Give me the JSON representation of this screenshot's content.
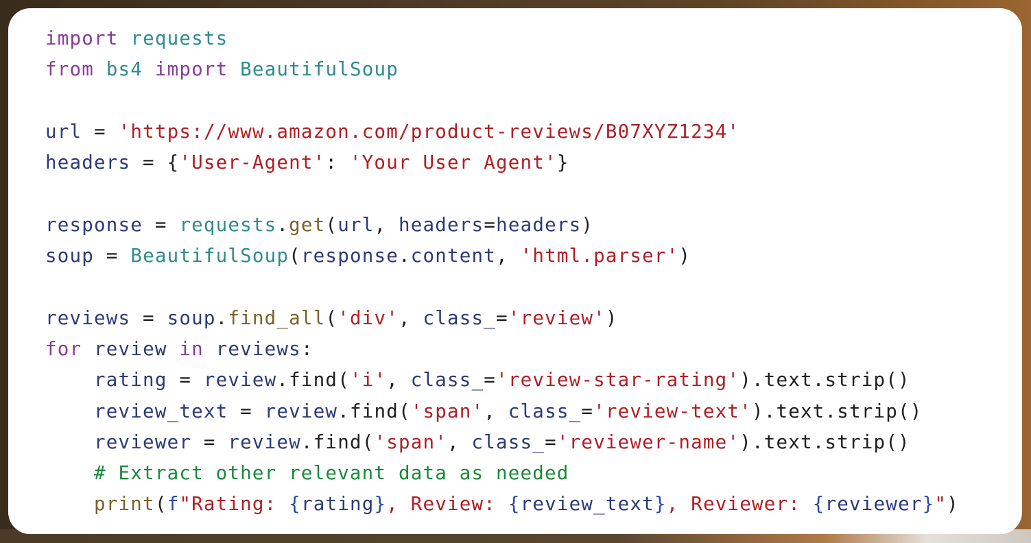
{
  "code_block": {
    "language": "python",
    "lines": [
      [
        {
          "t": "kw",
          "v": "import"
        },
        {
          "t": "op",
          "v": " "
        },
        {
          "t": "mod",
          "v": "requests"
        }
      ],
      [
        {
          "t": "kw",
          "v": "from"
        },
        {
          "t": "op",
          "v": " "
        },
        {
          "t": "mod",
          "v": "bs4"
        },
        {
          "t": "op",
          "v": " "
        },
        {
          "t": "kw",
          "v": "import"
        },
        {
          "t": "op",
          "v": " "
        },
        {
          "t": "mod",
          "v": "BeautifulSoup"
        }
      ],
      [],
      [
        {
          "t": "var",
          "v": "url"
        },
        {
          "t": "op",
          "v": " = "
        },
        {
          "t": "str",
          "v": "'https://www.amazon.com/product-reviews/B07XYZ1234'"
        }
      ],
      [
        {
          "t": "var",
          "v": "headers"
        },
        {
          "t": "op",
          "v": " = {"
        },
        {
          "t": "str",
          "v": "'User-Agent'"
        },
        {
          "t": "op",
          "v": ": "
        },
        {
          "t": "str",
          "v": "'Your User Agent'"
        },
        {
          "t": "op",
          "v": "}"
        }
      ],
      [],
      [
        {
          "t": "var",
          "v": "response"
        },
        {
          "t": "op",
          "v": " = "
        },
        {
          "t": "mod",
          "v": "requests"
        },
        {
          "t": "op",
          "v": "."
        },
        {
          "t": "fn",
          "v": "get"
        },
        {
          "t": "op",
          "v": "("
        },
        {
          "t": "var",
          "v": "url"
        },
        {
          "t": "op",
          "v": ", "
        },
        {
          "t": "var",
          "v": "headers"
        },
        {
          "t": "op",
          "v": "="
        },
        {
          "t": "var",
          "v": "headers"
        },
        {
          "t": "op",
          "v": ")"
        }
      ],
      [
        {
          "t": "var",
          "v": "soup"
        },
        {
          "t": "op",
          "v": " = "
        },
        {
          "t": "mod",
          "v": "BeautifulSoup"
        },
        {
          "t": "op",
          "v": "("
        },
        {
          "t": "var",
          "v": "response"
        },
        {
          "t": "op",
          "v": "."
        },
        {
          "t": "var",
          "v": "content"
        },
        {
          "t": "op",
          "v": ", "
        },
        {
          "t": "str",
          "v": "'html.parser'"
        },
        {
          "t": "op",
          "v": ")"
        }
      ],
      [],
      [
        {
          "t": "var",
          "v": "reviews"
        },
        {
          "t": "op",
          "v": " = "
        },
        {
          "t": "var",
          "v": "soup"
        },
        {
          "t": "op",
          "v": "."
        },
        {
          "t": "fn",
          "v": "find_all"
        },
        {
          "t": "op",
          "v": "("
        },
        {
          "t": "str",
          "v": "'div'"
        },
        {
          "t": "op",
          "v": ", "
        },
        {
          "t": "var",
          "v": "class_"
        },
        {
          "t": "op",
          "v": "="
        },
        {
          "t": "str",
          "v": "'review'"
        },
        {
          "t": "op",
          "v": ")"
        }
      ],
      [
        {
          "t": "kw",
          "v": "for"
        },
        {
          "t": "op",
          "v": " "
        },
        {
          "t": "var",
          "v": "review"
        },
        {
          "t": "op",
          "v": " "
        },
        {
          "t": "kw",
          "v": "in"
        },
        {
          "t": "op",
          "v": " "
        },
        {
          "t": "var",
          "v": "reviews"
        },
        {
          "t": "op",
          "v": ":"
        }
      ],
      [
        {
          "t": "op",
          "v": "    "
        },
        {
          "t": "var",
          "v": "rating"
        },
        {
          "t": "op",
          "v": " = "
        },
        {
          "t": "var",
          "v": "review"
        },
        {
          "t": "op",
          "v": ".find("
        },
        {
          "t": "str",
          "v": "'i'"
        },
        {
          "t": "op",
          "v": ", "
        },
        {
          "t": "var",
          "v": "class_"
        },
        {
          "t": "op",
          "v": "="
        },
        {
          "t": "str",
          "v": "'review-star-rating'"
        },
        {
          "t": "op",
          "v": ").text.strip()"
        }
      ],
      [
        {
          "t": "op",
          "v": "    "
        },
        {
          "t": "var",
          "v": "review_text"
        },
        {
          "t": "op",
          "v": " = "
        },
        {
          "t": "var",
          "v": "review"
        },
        {
          "t": "op",
          "v": ".find("
        },
        {
          "t": "str",
          "v": "'span'"
        },
        {
          "t": "op",
          "v": ", "
        },
        {
          "t": "var",
          "v": "class_"
        },
        {
          "t": "op",
          "v": "="
        },
        {
          "t": "str",
          "v": "'review-text'"
        },
        {
          "t": "op",
          "v": ").text.strip()"
        }
      ],
      [
        {
          "t": "op",
          "v": "    "
        },
        {
          "t": "var",
          "v": "reviewer"
        },
        {
          "t": "op",
          "v": " = "
        },
        {
          "t": "var",
          "v": "review"
        },
        {
          "t": "op",
          "v": ".find("
        },
        {
          "t": "str",
          "v": "'span'"
        },
        {
          "t": "op",
          "v": ", "
        },
        {
          "t": "var",
          "v": "class_"
        },
        {
          "t": "op",
          "v": "="
        },
        {
          "t": "str",
          "v": "'reviewer-name'"
        },
        {
          "t": "op",
          "v": ").text.strip()"
        }
      ],
      [
        {
          "t": "op",
          "v": "    "
        },
        {
          "t": "cm",
          "v": "# Extract other relevant data as needed"
        }
      ],
      [
        {
          "t": "op",
          "v": "    "
        },
        {
          "t": "fn",
          "v": "print"
        },
        {
          "t": "op",
          "v": "("
        },
        {
          "t": "fp",
          "v": "f"
        },
        {
          "t": "str",
          "v": "\"Rating: "
        },
        {
          "t": "fp",
          "v": "{"
        },
        {
          "t": "var",
          "v": "rating"
        },
        {
          "t": "fp",
          "v": "}"
        },
        {
          "t": "str",
          "v": ", Review: "
        },
        {
          "t": "fp",
          "v": "{"
        },
        {
          "t": "var",
          "v": "review_text"
        },
        {
          "t": "fp",
          "v": "}"
        },
        {
          "t": "str",
          "v": ", Reviewer: "
        },
        {
          "t": "fp",
          "v": "{"
        },
        {
          "t": "var",
          "v": "reviewer"
        },
        {
          "t": "fp",
          "v": "}"
        },
        {
          "t": "str",
          "v": "\""
        },
        {
          "t": "op",
          "v": ")"
        }
      ]
    ]
  }
}
